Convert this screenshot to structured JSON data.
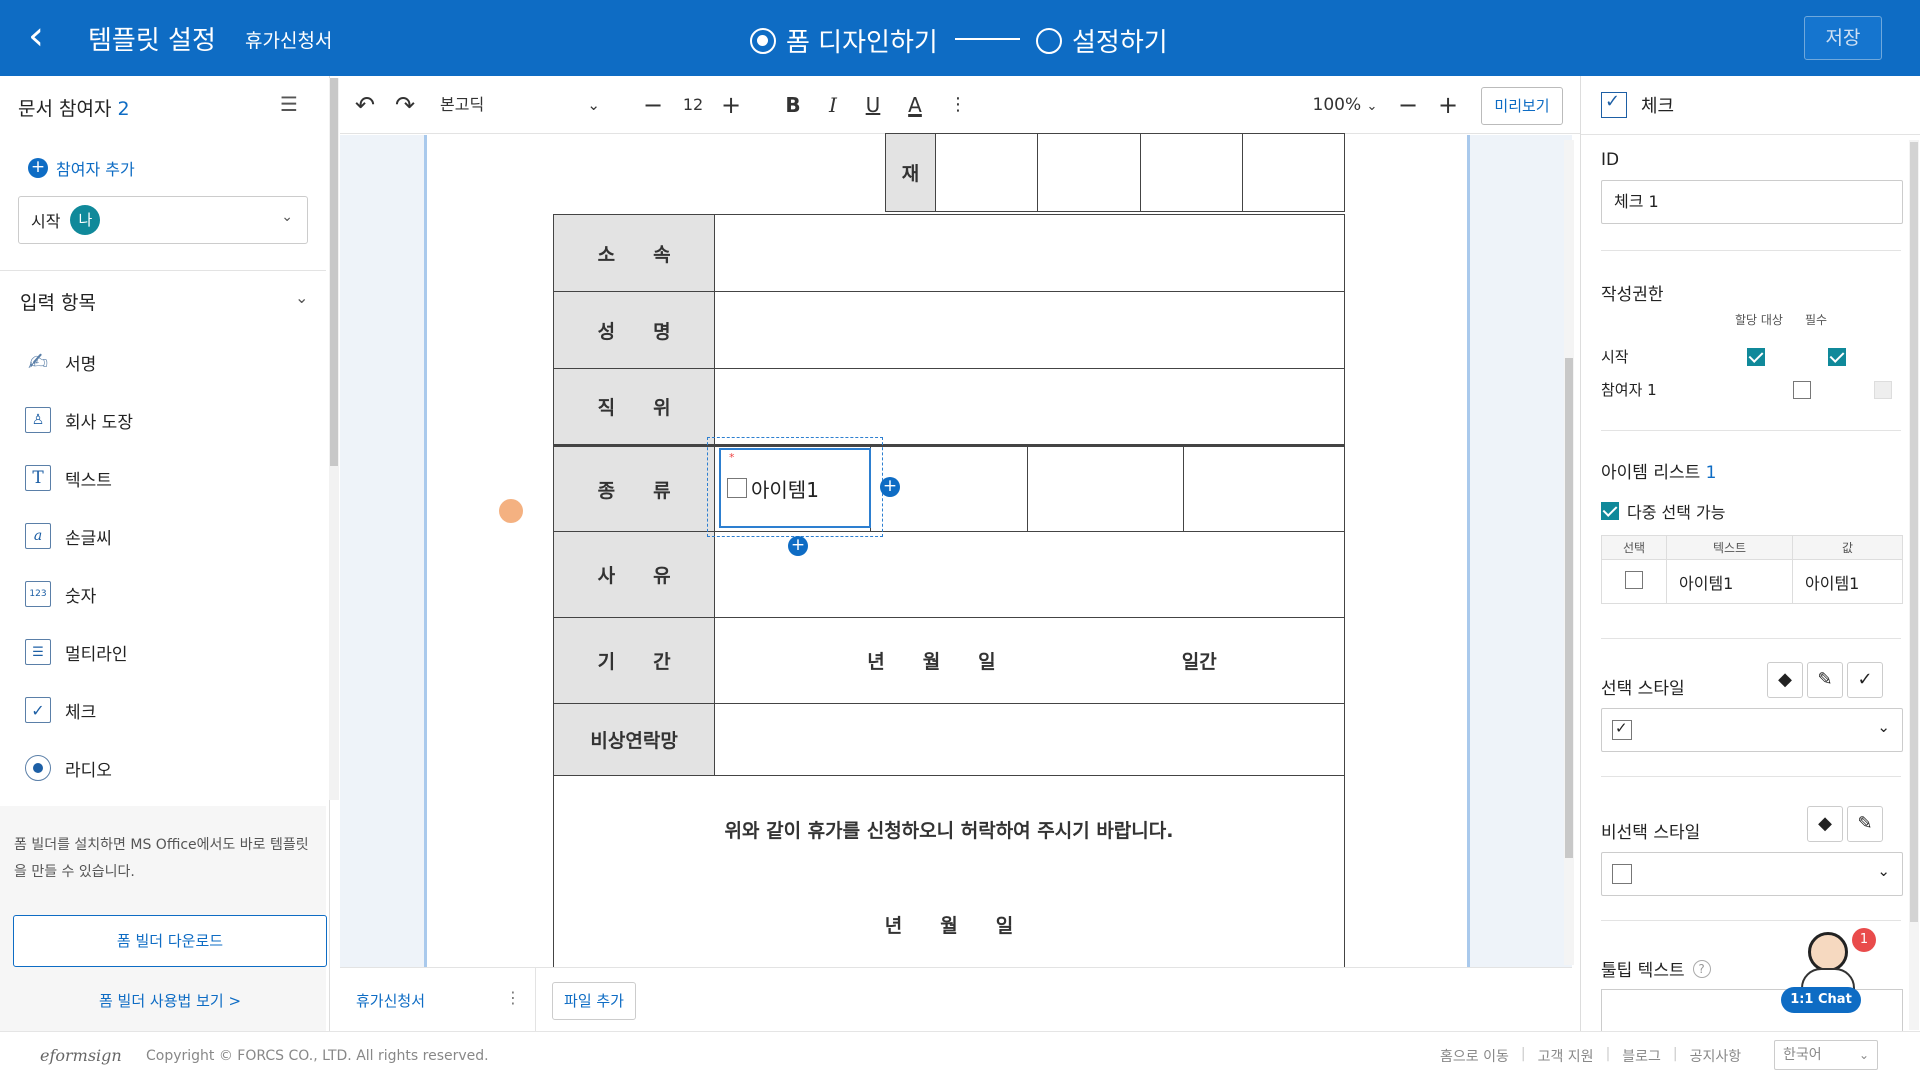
{
  "header": {
    "back_icon": "chevron-left-icon",
    "title": "템플릿 설정",
    "doc_name": "휴가신청서",
    "step1": "폼 디자인하기",
    "step2": "설정하기",
    "save": "저장"
  },
  "left": {
    "participants_label": "문서 참여자",
    "participants_count": "2",
    "add_participant": "참여자 추가",
    "select_prefix": "시작",
    "select_badge": "나",
    "input_items_label": "입력 항목",
    "items": [
      {
        "label": "서명",
        "icon": "signature-pen-icon"
      },
      {
        "label": "회사 도장",
        "icon": "stamp-icon"
      },
      {
        "label": "텍스트",
        "icon": "text-t-icon"
      },
      {
        "label": "손글씨",
        "icon": "handwriting-icon"
      },
      {
        "label": "숫자",
        "icon": "number-123-icon"
      },
      {
        "label": "멀티라인",
        "icon": "multiline-icon"
      },
      {
        "label": "체크",
        "icon": "checkbox-icon"
      },
      {
        "label": "라디오",
        "icon": "radio-icon"
      }
    ],
    "info_text": "폼 빌더를 설치하면 MS Office에서도 바로 템플릿을 만들 수 있습니다.",
    "download_btn": "폼 빌더 다운로드",
    "usage_link": "폼 빌더 사용법 보기 >"
  },
  "toolbar": {
    "font": "본고딕",
    "font_size": "12",
    "bold": "B",
    "italic": "I",
    "underline": "U",
    "color": "A",
    "zoom": "100%",
    "preview": "미리보기"
  },
  "form": {
    "top_label": "재",
    "rows": [
      {
        "label": "소  속"
      },
      {
        "label": "성  명"
      },
      {
        "label": "직  위"
      },
      {
        "label": "종  류"
      },
      {
        "label": "사  유"
      },
      {
        "label": "기  간"
      },
      {
        "label": "비상연락망"
      }
    ],
    "period_text": "년  월  일",
    "period_days": "일간",
    "check_item": "아이템1",
    "request_text": "위와 같이 휴가를 신청하오니 허락하여 주시기 바랍니다.",
    "date_text": "년  월  일"
  },
  "bottom": {
    "tab": "휴가신청서",
    "add_file": "파일 추가"
  },
  "right": {
    "header": "체크",
    "id_label": "ID",
    "id_value": "체크 1",
    "auth_label": "작성권한",
    "col_assign": "할당 대상",
    "col_required": "필수",
    "auth_rows": [
      {
        "name": "시작",
        "assign": true,
        "required": true
      },
      {
        "name": "참여자 1",
        "assign": false,
        "required": false
      }
    ],
    "item_list_label": "아이템 리스트",
    "item_list_count": "1",
    "multi_select": "다중 선택 가능",
    "table_headers": [
      "선택",
      "텍스트",
      "값"
    ],
    "table_rows": [
      {
        "text": "아이템1",
        "value": "아이템1"
      }
    ],
    "select_style_label": "선택 스타일",
    "unselect_style_label": "비선택 스타일",
    "tooltip_label": "툴팁 텍스트",
    "chat_label": "1:1 Chat",
    "chat_badge": "1"
  },
  "footer": {
    "logo": "eformsign",
    "copyright": "Copyright © FORCS CO., LTD. All rights reserved.",
    "links": [
      "홈으로 이동",
      "고객 지원",
      "블로그",
      "공지사항"
    ],
    "language": "한국어"
  },
  "colors": {
    "primary": "#0e6cc4",
    "teal": "#10899a"
  }
}
